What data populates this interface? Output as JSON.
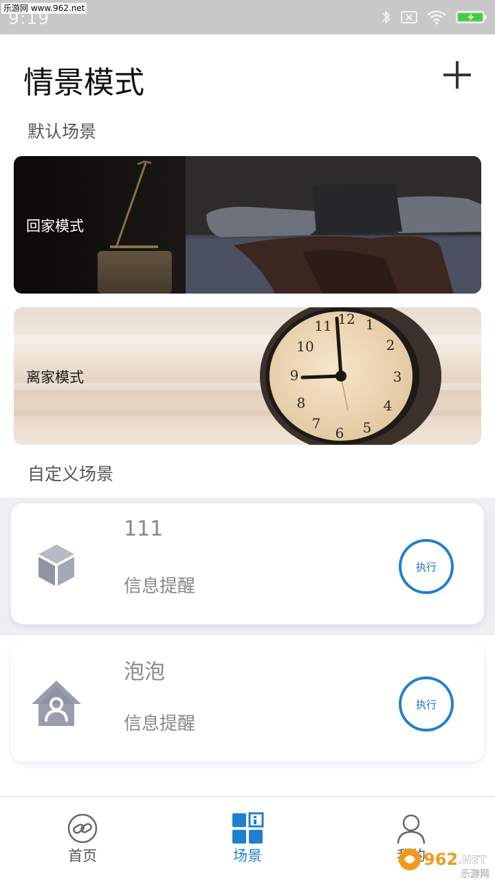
{
  "status_bar": {
    "time": "9:19",
    "watermark": "乐游网 www.962.net",
    "icons": [
      "bluetooth-icon",
      "sim-disabled-icon",
      "wifi-icon",
      "battery-charging-icon"
    ],
    "background": "#c8c8c8"
  },
  "header": {
    "title": "情景模式",
    "add_icon": "plus-icon"
  },
  "default_section": {
    "label": "默认场景",
    "scenes": [
      {
        "label": "回家模式",
        "image": "dark bedroom with lamp"
      },
      {
        "label": "离家模式",
        "image": "alarm clock"
      }
    ]
  },
  "custom_section": {
    "label": "自定义场景",
    "items": [
      {
        "name": "111",
        "subtitle": "信息提醒",
        "icon": "cube-icon",
        "action": "执行"
      },
      {
        "name": "泡泡",
        "subtitle": "信息提醒",
        "icon": "home-person-icon",
        "action": "执行"
      }
    ]
  },
  "bottom_nav": {
    "items": [
      {
        "label": "首页",
        "icon": "link-circle-icon",
        "active": false
      },
      {
        "label": "场景",
        "icon": "grid-scene-icon",
        "active": true
      },
      {
        "label": "我的",
        "icon": "user-icon",
        "active": false
      }
    ],
    "watermark": "962.NET 乐游网"
  },
  "colors": {
    "accent": "#1e7fd0",
    "text_primary": "#111111",
    "text_secondary": "#888888"
  }
}
